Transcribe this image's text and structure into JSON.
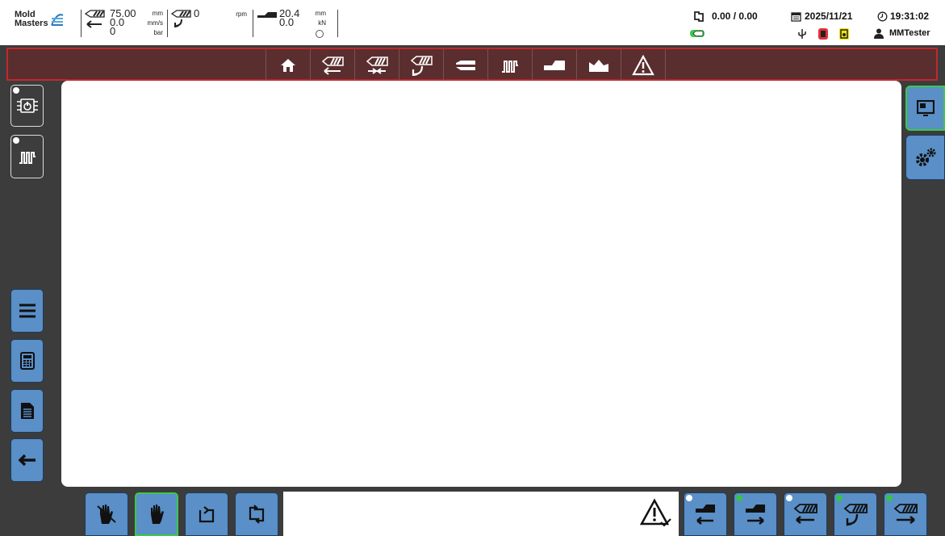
{
  "header": {
    "logo_line1": "Mold",
    "logo_line2": "Masters",
    "injection_position": "75.00",
    "injection_speed": "0.0",
    "injection_pressure": "0",
    "unit_position": "mm",
    "unit_speed": "mm/s",
    "unit_pressure": "bar",
    "screw_rpm": "0",
    "unit_rpm": "rpm",
    "carriage_position": "20.4",
    "carriage_force": "0.0",
    "unit_carriage_pos": "mm",
    "unit_carriage_force": "kN",
    "cycle_times": "0.00 / 0.00",
    "date": "2025/11/21",
    "time": "19:31:02",
    "user": "MMTester"
  },
  "nav": {
    "items": [
      "home-icon",
      "injection-icon",
      "hold-icon",
      "screw-rotate-icon",
      "nozzle-icon",
      "heater-icon",
      "carriage-icon",
      "profile-icon",
      "alarm-icon"
    ]
  },
  "colors": {
    "nav_bg": "#5a2e2e",
    "nav_border": "#c0282f",
    "button_blue": "#5a8fc7",
    "active_green": "#3ec84a"
  }
}
